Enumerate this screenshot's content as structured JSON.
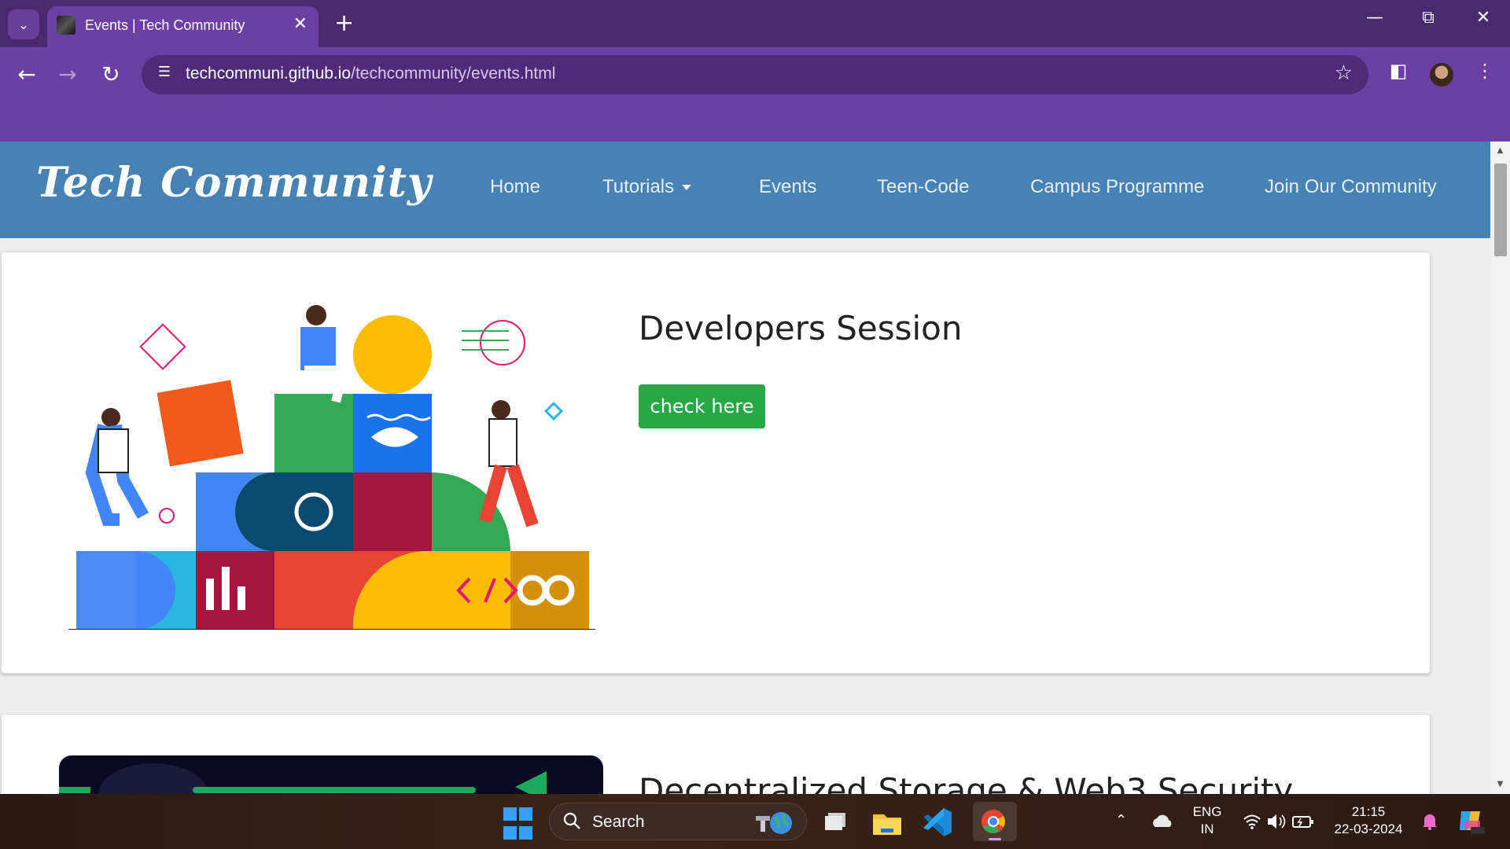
{
  "browser": {
    "tab_title": "Events | Tech Community",
    "url_domain": "techcommuni.github.io",
    "url_path": "/techcommunity/events.html",
    "icons": {
      "tab_menu": "chevron-down-icon",
      "close_tab": "close-icon",
      "new_tab": "plus-icon",
      "back": "arrow-left-icon",
      "forward": "arrow-right-icon",
      "reload": "reload-icon",
      "site_info": "tune-icon",
      "bookmark": "star-icon",
      "side_panel": "side-panel-icon",
      "menu": "more-vertical-icon"
    }
  },
  "site": {
    "brand": "Tech Community",
    "nav": [
      {
        "label": "Home"
      },
      {
        "label": "Tutorials"
      },
      {
        "label": "Events"
      },
      {
        "label": "Teen-Code"
      },
      {
        "label": "Campus Programme"
      },
      {
        "label": "Join Our Community"
      }
    ],
    "colors": {
      "navbar": "#4682b4",
      "button": "#28a745"
    }
  },
  "events": [
    {
      "title": "Developers Session",
      "button": "check here"
    },
    {
      "title": "Decentralized Storage & Web3 Security"
    }
  ],
  "taskbar": {
    "search_label": "Search",
    "language": "ENG",
    "region": "IN",
    "time": "21:15",
    "date": "22-03-2024"
  }
}
